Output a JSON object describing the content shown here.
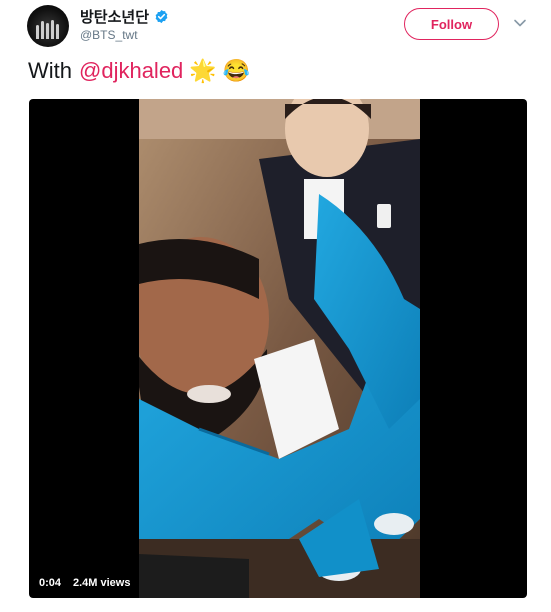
{
  "tweet": {
    "display_name": "방탄소년단",
    "handle": "@BTS_twt",
    "verified_icon": "verified-badge-icon",
    "follow_label": "Follow",
    "more_icon": "chevron-down-icon",
    "text_prefix": "With",
    "mention": "@djkhaled",
    "emojis": [
      "🌟",
      "😂"
    ]
  },
  "video": {
    "time": "0:04",
    "views": "2.4M views"
  },
  "colors": {
    "accent": "#e0245e",
    "verified": "#1da1f2",
    "text": "#14171a",
    "muted": "#657786"
  }
}
